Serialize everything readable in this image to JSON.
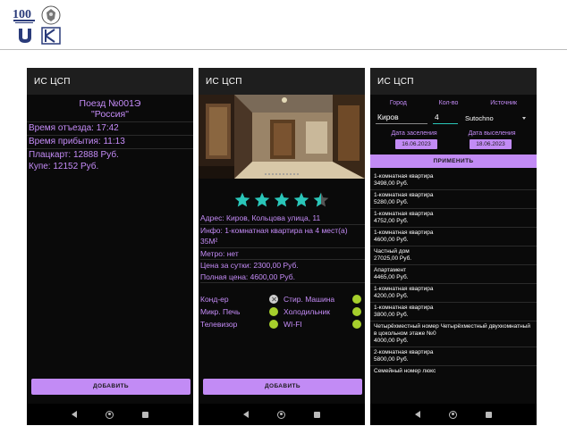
{
  "phone1": {
    "app_title": "ИС ЦСП",
    "train_number": "Поезд №001Э",
    "train_name": "\"Россия\"",
    "departure": "Время отъезда: 17:42",
    "arrival": "Время прибытия: 11:13",
    "platzkart": "Плацкарт: 12888 Руб.",
    "kupe": "Купе: 12152 Руб.",
    "add_label": "ДОБАВИТЬ"
  },
  "phone2": {
    "app_title": "ИС ЦСП",
    "rating": 4.5,
    "address": "Адрес: Киров, Кольцова улица, 11",
    "info_line1": "Инфо: 1-комнатная квартира на 4 мест(а)",
    "info_line2": "35М²",
    "metro": "Метро: нет",
    "price_day": "Цена за сутки: 2300,00 Руб.",
    "price_full": "Полная цена: 4600,00 Руб.",
    "features": [
      {
        "label": "Конд-ер",
        "on": false
      },
      {
        "label": "Стир. Машина",
        "on": true
      },
      {
        "label": "Микр. Печь",
        "on": true
      },
      {
        "label": "Холодильник",
        "on": true
      },
      {
        "label": "Телевизор",
        "on": true
      },
      {
        "label": "WI-FI",
        "on": true
      }
    ],
    "add_label": "ДОБАВИТЬ"
  },
  "phone3": {
    "app_title": "ИС ЦСП",
    "label_city": "Город",
    "label_count": "Кол-во",
    "label_source": "Источник",
    "city_value": "Киров",
    "count_value": "4",
    "source_value": "Sutochno",
    "label_checkin": "Дата заселения",
    "label_checkout": "Дата выселения",
    "checkin_value": "16.06.2023",
    "checkout_value": "18.06.2023",
    "apply_label": "ПРИМЕНИТЬ",
    "items": [
      {
        "name": "1-комнатная квартира",
        "price": "3498,00 Руб."
      },
      {
        "name": "1-комнатная квартира",
        "price": "5280,00 Руб."
      },
      {
        "name": "1-комнатная квартира",
        "price": "4752,00 Руб."
      },
      {
        "name": "1-комнатная квартира",
        "price": "4600,00 Руб."
      },
      {
        "name": "Частный дом",
        "price": "27025,00 Руб."
      },
      {
        "name": "Апартамент",
        "price": "4465,00 Руб."
      },
      {
        "name": "1-комнатная квартира",
        "price": "4200,00 Руб."
      },
      {
        "name": "1-комнатная квартира",
        "price": "3800,00 Руб."
      },
      {
        "name": "Четырёхместный номер Четырёхместный двухкомнатный в цокольном этаже №0",
        "price": "4000,00 Руб."
      },
      {
        "name": "2-комнатная квартира",
        "price": "5800,00 Руб."
      },
      {
        "name": "Семейный номер люкс",
        "price": ""
      }
    ]
  },
  "colors": {
    "accent": "#c28bf5",
    "text_purple": "#c58cf8",
    "star": "#2ac6b9",
    "feature_on": "#a6cf2c"
  }
}
